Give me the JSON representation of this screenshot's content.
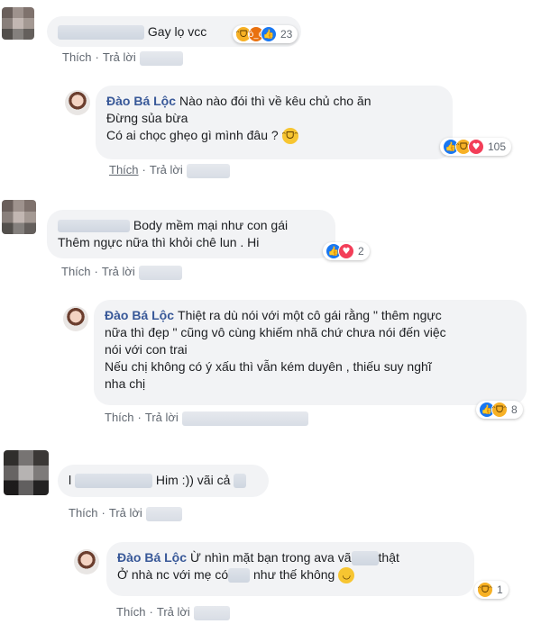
{
  "actions": {
    "like": "Thích",
    "reply": "Trả lời"
  },
  "comments": [
    {
      "text": "Gay lọ vcc",
      "reaction_count": "23"
    },
    {
      "author": "Đào Bá Lộc",
      "lines": [
        "Nào nào đói thì về kêu chủ cho ăn",
        "Đừng sủa bừa",
        "Có ai chọc ghẹo gì mình đâu ?"
      ],
      "reaction_count": "105"
    },
    {
      "author_partial": "T        Anh",
      "lines": [
        "Body mềm mại như con gái",
        "Thêm ngực nữa thì khỏi chê lun . Hi"
      ],
      "reaction_count": "2"
    },
    {
      "author": "Đào Bá Lộc",
      "lines": [
        "Thiệt ra dù nói với một cô gái rằng \" thêm ngực",
        "nữa thì đẹp \" cũng vô cùng khiếm nhã chứ chưa nói đến việc",
        "nói với con trai",
        "Nếu chị không có ý xấu thì vẫn kém duyên , thiếu suy nghĩ",
        "nha chị"
      ],
      "reaction_count": "8"
    },
    {
      "text_prefix": "l",
      "text": "Him :)) vãi cả",
      "reaction_count": ""
    },
    {
      "author": "Đào Bá Lộc",
      "lines": [
        "Ừ nhìn mặt bạn trong ava vã",
        "thật",
        "Ở nhà nc với mẹ có",
        "như thế không"
      ],
      "reaction_count": "1"
    }
  ],
  "colors": {
    "bubble": "#f2f3f5",
    "author": "#385898",
    "meta": "#606770"
  }
}
